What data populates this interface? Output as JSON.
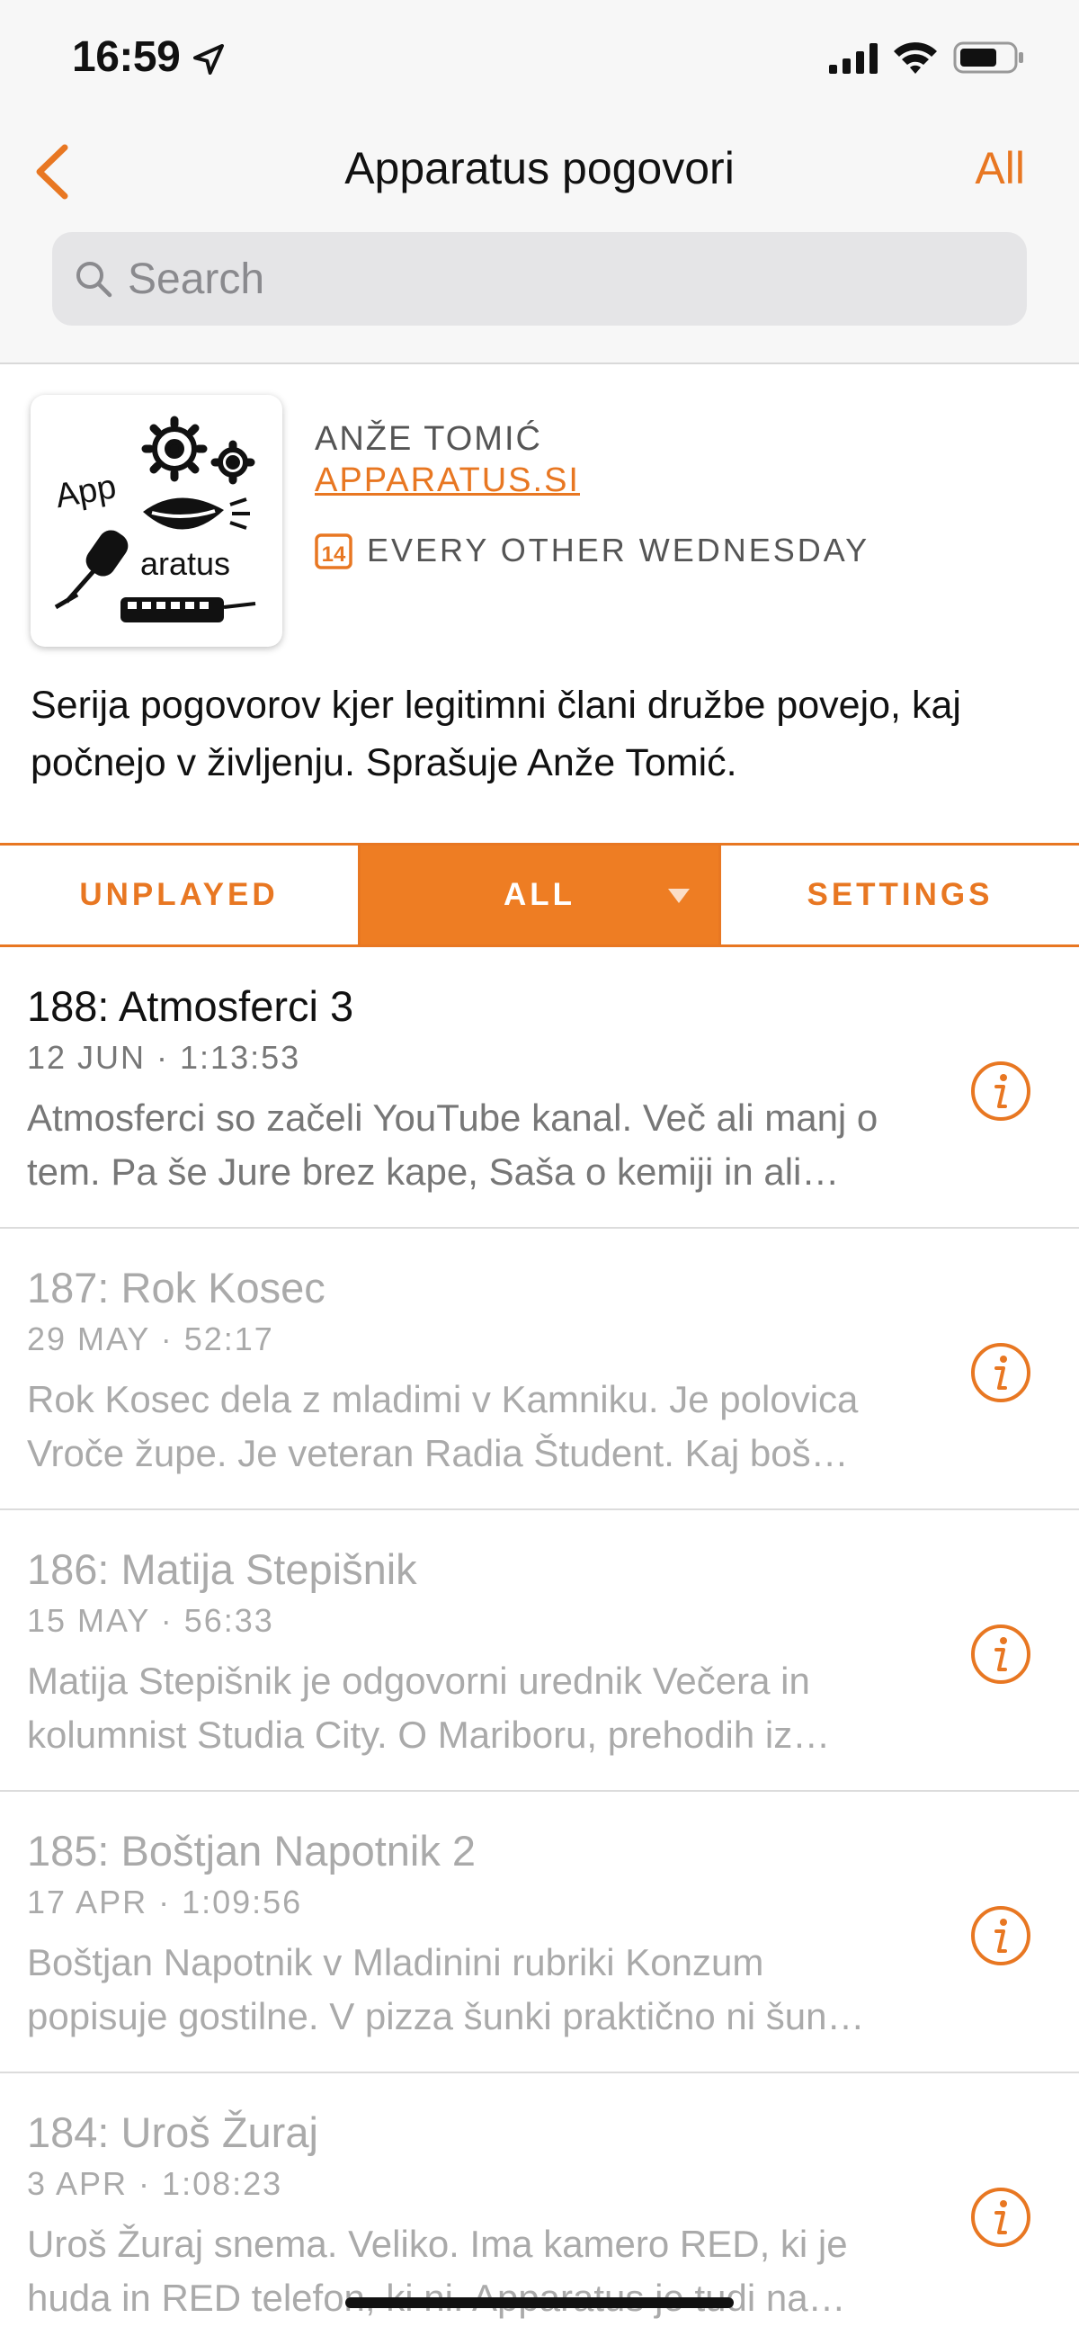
{
  "status_bar": {
    "time": "16:59"
  },
  "nav": {
    "title": "Apparatus pogovori",
    "right_action": "All"
  },
  "search": {
    "placeholder": "Search"
  },
  "podcast": {
    "artwork_text_1": "App",
    "artwork_text_2": "aratus",
    "author": "ANŽE TOMIĆ",
    "website": "APPARATUS.SI",
    "calendar_day": "14",
    "schedule": "EVERY OTHER WEDNESDAY",
    "description": "Serija pogovorov kjer legitimni člani družbe povejo, kaj počnejo v življenju. Sprašuje Anže Tomić."
  },
  "tabs": {
    "unplayed": "UNPLAYED",
    "all": "ALL",
    "settings": "SETTINGS"
  },
  "episodes": [
    {
      "title": "188: Atmosferci 3",
      "meta": "12 JUN · 1:13:53",
      "summary": "Atmosferci so začeli YouTube kanal. Več ali manj o tem. Pa še Jure brez kape, Saša o kemiji in ali…"
    },
    {
      "title": "187: Rok Kosec",
      "meta": "29 MAY · 52:17",
      "summary": "Rok Kosec dela z mladimi v Kamniku. Je polovica Vroče župe. Je veteran Radia Študent. Kaj boš…"
    },
    {
      "title": "186: Matija Stepišnik",
      "meta": "15 MAY · 56:33",
      "summary": "Matija Stepišnik je odgovorni urednik Večera in kolumnist Studia City. O Mariboru, prehodih iz…"
    },
    {
      "title": "185: Boštjan Napotnik 2",
      "meta": "17 APR · 1:09:56",
      "summary": "Boštjan Napotnik v Mladinini rubriki Konzum popisuje gostilne. V pizza šunki praktično ni šun…"
    },
    {
      "title": "184: Uroš Žuraj",
      "meta": "3 APR · 1:08:23",
      "summary": "Uroš Žuraj snema. Veliko. Ima kamero RED, ki je huda in RED telefon, ki ni. Apparatus je tudi na…"
    }
  ],
  "colors": {
    "accent": "#e87722",
    "played_text": "#aaaaaa"
  }
}
